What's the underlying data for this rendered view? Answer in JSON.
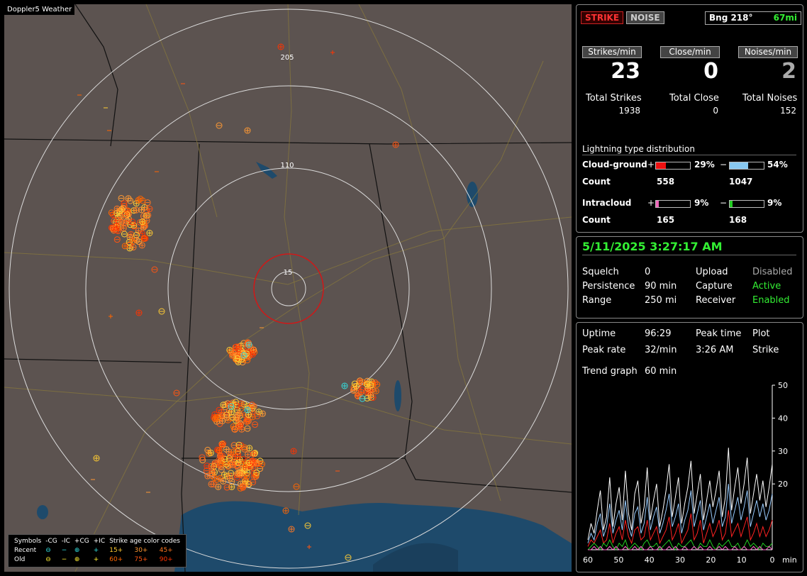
{
  "app": {
    "title": "Doppler5 Weather"
  },
  "map": {
    "range_labels": [
      "205",
      "110",
      "15"
    ],
    "colors": {
      "background": "#5c5350",
      "water": "#1e4a6b",
      "rings": "#dcdcdc",
      "center_ring": "#d01818"
    }
  },
  "legend": {
    "symbols_label": "Symbols",
    "cols": [
      "-CG",
      "-IC",
      "+CG",
      "+IC"
    ],
    "age_label": "Strike age color codes",
    "rows": [
      {
        "label": "Recent",
        "ages": [
          "15+",
          "30+",
          "45+"
        ]
      },
      {
        "label": "Old",
        "ages": [
          "60+",
          "75+",
          "90+"
        ]
      }
    ],
    "age_colors": [
      "#ffcc33",
      "#ff9933",
      "#ff7722",
      "#ff6600",
      "#ff5511",
      "#ff3300"
    ]
  },
  "counter_panel": {
    "strike_btn": "STRIKE",
    "noise_btn": "NOISE",
    "bearing_label": "Bng 218°",
    "distance": "67mi",
    "strikes_min_label": "Strikes/min",
    "close_min_label": "Close/min",
    "noises_min_label": "Noises/min",
    "strikes_min": "23",
    "close_min": "0",
    "noises_min": "2",
    "total_strikes_label": "Total Strikes",
    "total_close_label": "Total Close",
    "total_noises_label": "Total Noises",
    "total_strikes": "1938",
    "total_close": "0",
    "total_noises": "152",
    "dist_title": "Lightning type distribution",
    "cg_label": "Cloud-ground",
    "ic_label": "Intracloud",
    "count_label": "Count",
    "plus": "+",
    "minus": "−",
    "cg_pos_pct": "29%",
    "cg_neg_pct": "54%",
    "ic_pos_pct": "9%",
    "ic_neg_pct": "9%",
    "cg_pos_fill": 0.29,
    "cg_neg_fill": 0.54,
    "ic_pos_fill": 0.09,
    "ic_neg_fill": 0.09,
    "cg_pos_count": "558",
    "cg_neg_count": "1047",
    "ic_pos_count": "165",
    "ic_neg_count": "168"
  },
  "status_panel": {
    "datetime": "5/11/2025 3:27:17 AM",
    "squelch_label": "Squelch",
    "squelch": "0",
    "upload_label": "Upload",
    "upload": "Disabled",
    "persistence_label": "Persistence",
    "persistence": "90 min",
    "capture_label": "Capture",
    "capture": "Active",
    "range_label": "Range",
    "range": "250 mi",
    "receiver_label": "Receiver",
    "receiver": "Enabled"
  },
  "trend_panel": {
    "uptime_label": "Uptime",
    "uptime": "96:29",
    "peak_time_label": "Peak time",
    "plot_label": "Plot",
    "peak_rate_label": "Peak rate",
    "peak_rate": "32/min",
    "peak_time": "3:26 AM",
    "plot": "Strike",
    "trend_label": "Trend graph",
    "trend_window": "60 min"
  },
  "chart_data": {
    "type": "line",
    "xlabel": "min",
    "x_ticks": [
      "60",
      "50",
      "40",
      "30",
      "20",
      "10",
      "0"
    ],
    "y_ticks": [
      "50",
      "40",
      "30",
      "20"
    ],
    "ylim": [
      0,
      50
    ],
    "xlim": [
      60,
      0
    ],
    "series": [
      {
        "color": "#ffffff",
        "values": [
          3,
          8,
          5,
          12,
          18,
          6,
          10,
          22,
          7,
          14,
          19,
          9,
          24,
          11,
          6,
          17,
          21,
          8,
          13,
          25,
          9,
          15,
          20,
          7,
          12,
          18,
          26,
          10,
          16,
          22,
          8,
          14,
          19,
          27,
          11,
          17,
          23,
          9,
          15,
          21,
          13,
          18,
          24,
          10,
          16,
          31,
          12,
          19,
          25,
          14,
          20,
          28,
          11,
          17,
          23,
          15,
          21,
          13,
          19,
          26
        ]
      },
      {
        "color": "#99ccff",
        "values": [
          2,
          5,
          3,
          8,
          11,
          4,
          7,
          14,
          5,
          9,
          12,
          6,
          15,
          7,
          4,
          11,
          13,
          5,
          8,
          16,
          6,
          10,
          13,
          5,
          8,
          12,
          17,
          7,
          10,
          14,
          5,
          9,
          12,
          18,
          7,
          11,
          15,
          6,
          10,
          14,
          8,
          12,
          16,
          7,
          10,
          20,
          8,
          12,
          16,
          9,
          13,
          18,
          7,
          11,
          15,
          10,
          14,
          9,
          12,
          17
        ]
      },
      {
        "color": "#ff2222",
        "values": [
          1,
          3,
          2,
          4,
          6,
          2,
          3,
          8,
          2,
          5,
          7,
          3,
          9,
          4,
          2,
          6,
          7,
          3,
          4,
          9,
          3,
          5,
          7,
          2,
          4,
          6,
          10,
          3,
          5,
          8,
          2,
          4,
          6,
          11,
          3,
          5,
          9,
          2,
          5,
          8,
          4,
          6,
          9,
          3,
          5,
          12,
          4,
          6,
          8,
          4,
          7,
          10,
          3,
          5,
          8,
          4,
          7,
          4,
          6,
          9
        ]
      },
      {
        "color": "#22cc22",
        "values": [
          0,
          1,
          2,
          1,
          0,
          2,
          1,
          3,
          1,
          0,
          2,
          1,
          3,
          0,
          1,
          2,
          1,
          0,
          2,
          3,
          1,
          1,
          2,
          0,
          1,
          2,
          3,
          1,
          0,
          2,
          1,
          1,
          2,
          3,
          1,
          0,
          2,
          1,
          1,
          3,
          1,
          0,
          2,
          1,
          2,
          3,
          1,
          1,
          2,
          0,
          1,
          3,
          1,
          2,
          1,
          0,
          2,
          1,
          1,
          2
        ]
      },
      {
        "color": "#ff66cc",
        "values": [
          0,
          0,
          1,
          0,
          1,
          0,
          0,
          1,
          0,
          1,
          0,
          0,
          1,
          0,
          0,
          1,
          0,
          1,
          0,
          0,
          1,
          0,
          0,
          1,
          0,
          0,
          1,
          0,
          1,
          0,
          0,
          1,
          0,
          0,
          1,
          0,
          1,
          0,
          0,
          1,
          0,
          0,
          1,
          0,
          1,
          0,
          0,
          1,
          0,
          0,
          1,
          0,
          0,
          1,
          0,
          1,
          0,
          0,
          1,
          0
        ]
      }
    ]
  }
}
